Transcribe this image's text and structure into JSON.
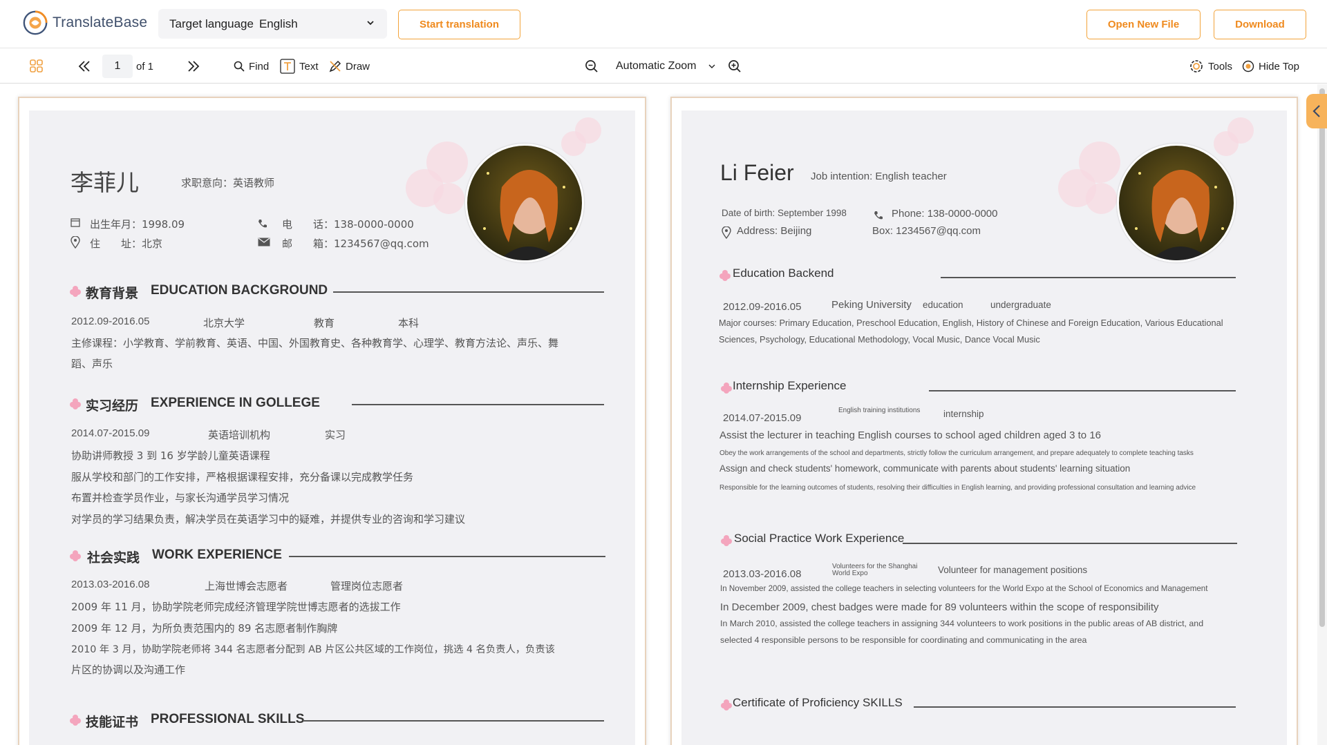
{
  "app": {
    "name": "TranslateBase",
    "target_language_label": "Target language",
    "target_language_value": "English",
    "start_translation": "Start translation",
    "open_new_file": "Open New File",
    "download": "Download",
    "colors": {
      "accent": "#ef8a1e",
      "accent_border": "#f3a33a"
    }
  },
  "toolbar": {
    "page_current": "1",
    "page_total": "of 1",
    "find": "Find",
    "text": "Text",
    "draw": "Draw",
    "zoom": "Automatic Zoom",
    "tools": "Tools",
    "hide_top": "Hide Top"
  },
  "original": {
    "name": "李菲儿",
    "intention": "求职意向：英语教师",
    "birth": "出生年月：1998.09",
    "address": "住　　址：北京",
    "phone": "电　　话：138-0000-0000",
    "email": "邮　　箱：1234567@qq.com",
    "sections": {
      "education": {
        "cn": "教育背景",
        "en": "EDUCATION BACKGROUND"
      },
      "internship": {
        "cn": "实习经历",
        "en": "EXPERIENCE IN GOLLEGE"
      },
      "work": {
        "cn": "社会实践",
        "en": "WORK EXPERIENCE"
      },
      "skills": {
        "cn": "技能证书",
        "en": "PROFESSIONAL SKILLS"
      }
    },
    "edu_row": [
      "2012.09-2016.05",
      "北京大学",
      "教育",
      "本科"
    ],
    "edu_courses_1": "主修课程：小学教育、学前教育、英语、中国、外国教育史、各种教育学、心理学、教育方法论、声乐、舞",
    "edu_courses_2": "蹈、声乐",
    "intern_row": [
      "2014.07-2015.09",
      "英语培训机构",
      "实习"
    ],
    "intern_lines": [
      "协助讲师教授 3 到 16 岁学龄儿童英语课程",
      "服从学校和部门的工作安排，严格根据课程安排，充分备课以完成教学任务",
      "布置并检查学员作业，与家长沟通学员学习情况",
      "对学员的学习结果负责，解决学员在英语学习中的疑难，并提供专业的咨询和学习建议"
    ],
    "work_row": [
      "2013.03-2016.08",
      "上海世博会志愿者",
      "管理岗位志愿者"
    ],
    "work_lines": [
      "2009 年 11 月，协助学院老师完成经济管理学院世博志愿者的选拔工作",
      "2009 年 12 月，为所负责范围内的 89 名志愿者制作胸牌",
      "2010 年 3 月，协助学院老师将 344 名志愿者分配到 AB 片区公共区域的工作岗位，挑选 4 名负责人，负责该",
      "片区的协调以及沟通工作"
    ]
  },
  "translated": {
    "name": "Li Feier",
    "intention": "Job intention: English teacher",
    "birth": "Date of birth: September 1998",
    "address": "Address: Beijing",
    "phone": "Phone: 138-0000-0000",
    "email": "Box: 1234567@qq.com",
    "sections": {
      "education": "Education Backend",
      "internship": "Internship Experience",
      "work": "Social Practice Work Experience",
      "skills": "Certificate of Proficiency SKILLS"
    },
    "edu_row": [
      "2012.09-2016.05",
      "Peking University",
      "education",
      "undergraduate"
    ],
    "edu_courses_1": "Major courses: Primary Education, Preschool Education, English, History of Chinese and Foreign Education, Various Educational",
    "edu_courses_2": "Sciences, Psychology, Educational Methodology, Vocal Music, Dance Vocal Music",
    "intern_row": [
      "2014.07-2015.09",
      "English training institutions",
      "internship"
    ],
    "intern_lines": [
      "Assist the lecturer in teaching English courses to school aged children aged 3 to 16",
      "Obey the work arrangements of the school and departments, strictly follow the curriculum arrangement, and prepare adequately to complete teaching tasks",
      "Assign and check students' homework, communicate with parents about students' learning situation",
      "Responsible for the learning outcomes of students, resolving their difficulties in English learning, and providing professional consultation and learning advice"
    ],
    "work_row": [
      "2013.03-2016.08",
      "Volunteers for the Shanghai",
      "World Expo",
      "Volunteer for management positions"
    ],
    "work_lines": [
      "In November 2009, assisted the college teachers in selecting volunteers for the World Expo at the School of Economics and Management",
      "In December 2009, chest badges were made for 89 volunteers within the scope of responsibility",
      "In March 2010, assisted the college teachers in assigning 344 volunteers to work positions in the public areas of AB district, and",
      "selected 4 responsible persons to be responsible for coordinating and communicating in the area"
    ]
  }
}
